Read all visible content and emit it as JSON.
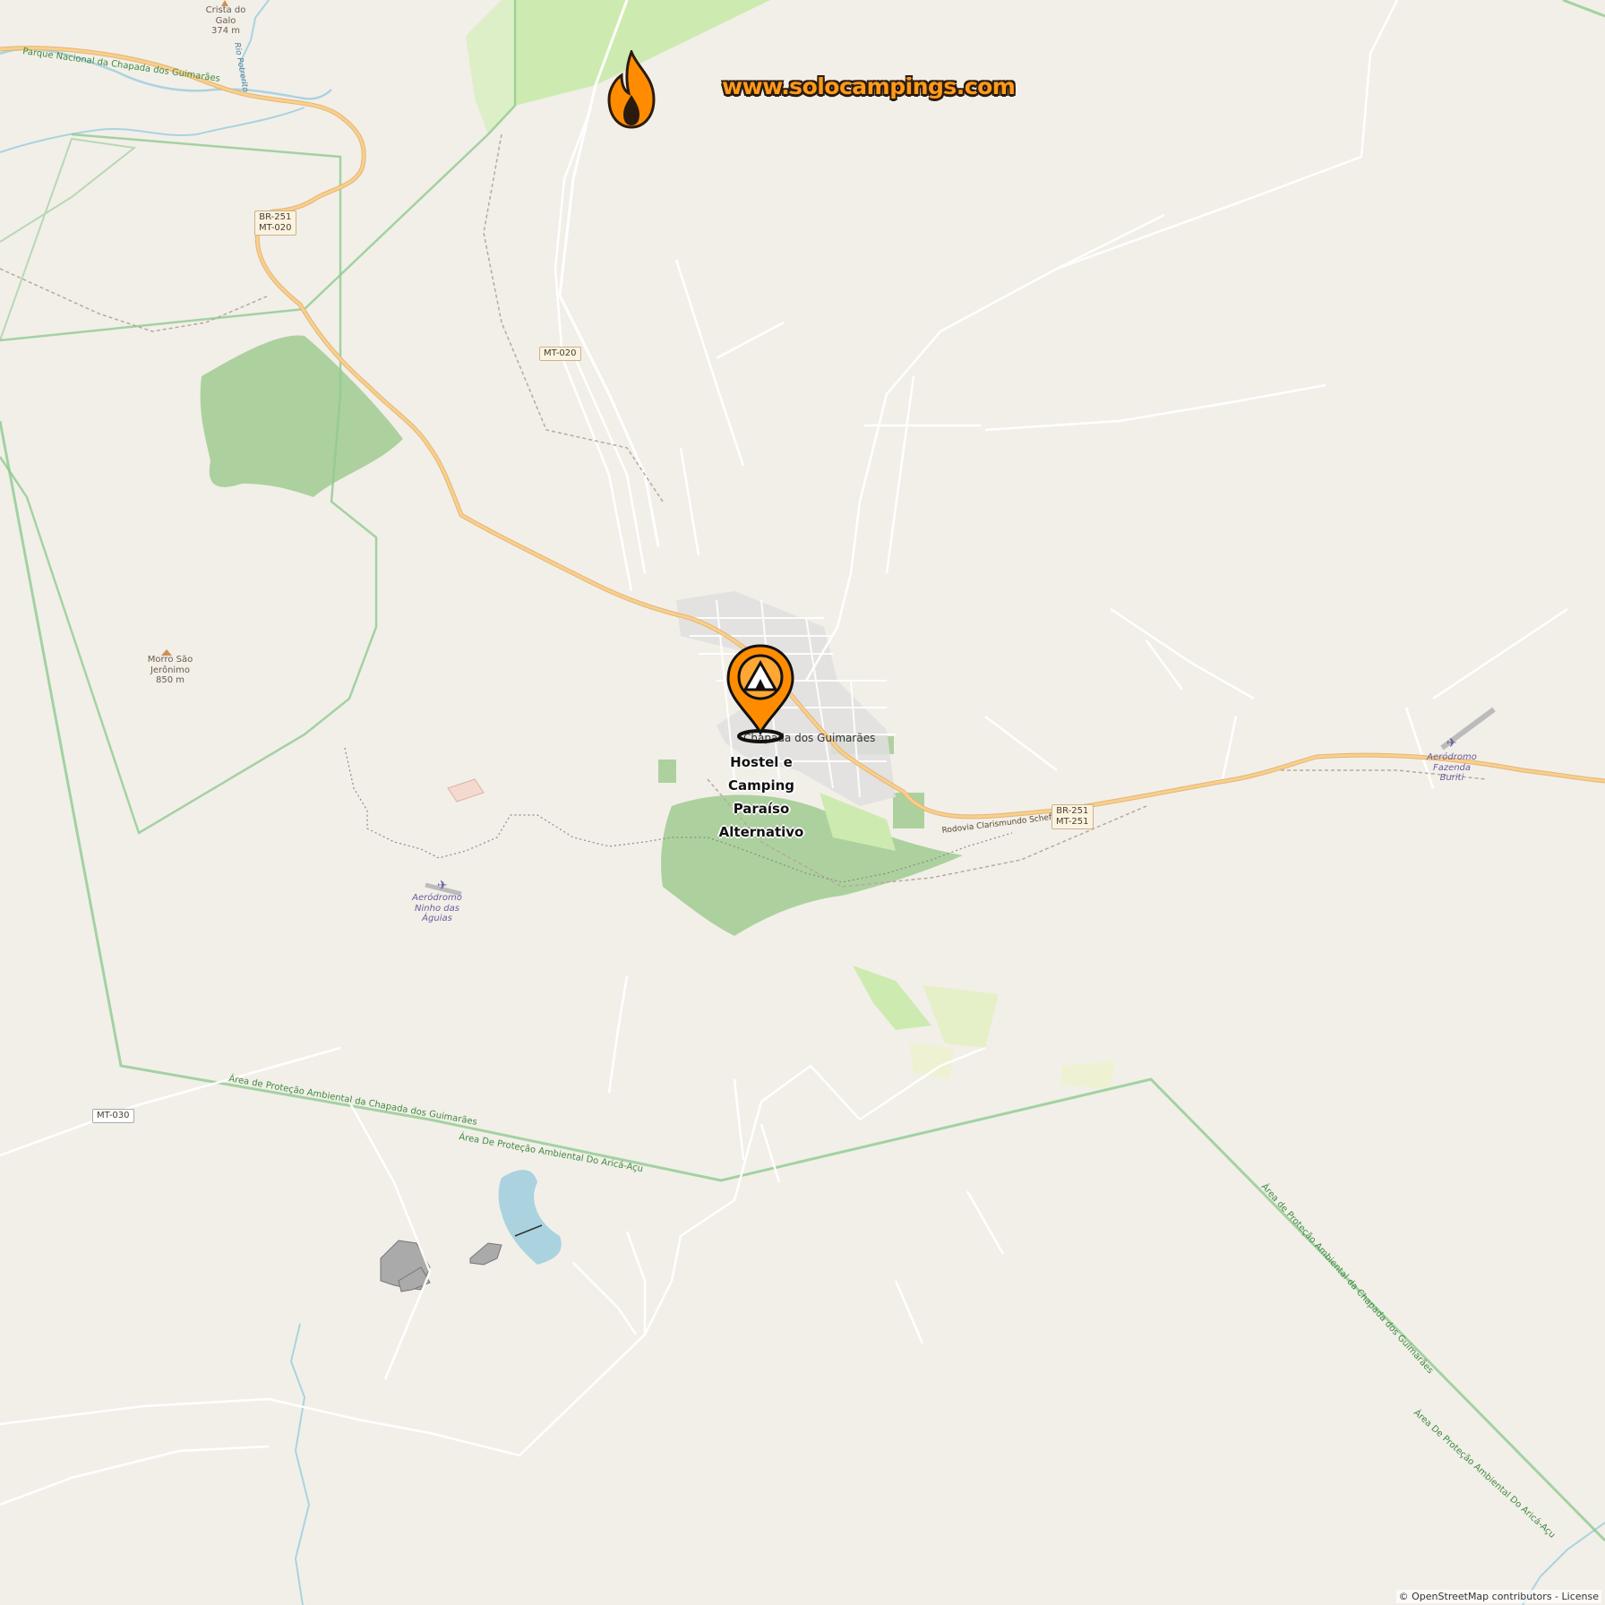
{
  "brand": {
    "text": "www.solocampings.com",
    "accent": "#ff9a1a"
  },
  "poi": {
    "name_lines": [
      "Hostel e",
      "Camping",
      "Paraíso",
      "Alternativo"
    ],
    "icon": "tent-map-pin-icon",
    "color": "#ff8c00"
  },
  "places": {
    "crista_do_galo": {
      "name": "Crista do Galo",
      "elevation": "374 m"
    },
    "morro_sao_jeronimo": {
      "name": "Morro São Jerônimo",
      "elevation": "850 m"
    },
    "town": {
      "name": "Chapada dos Guimarães"
    },
    "aerodromo_ninho": {
      "name": "Aeródromo Ninho das Águias"
    },
    "aerodromo_buriti": {
      "name": "Aeródromo Fazenda Buriti"
    }
  },
  "roads": {
    "br251_mt020": [
      "BR-251",
      "MT-020"
    ],
    "mt020": "MT-020",
    "br251_mt251": [
      "BR-251",
      "MT-251"
    ],
    "mt030": "MT-030",
    "rodovia": "Rodovia Clarismundo Scheffer",
    "rio": "Rio Potrerito"
  },
  "areas": {
    "parque": "Parque Nacional da Chapada dos Guimarães",
    "apa_chapada": "Área de Proteção Ambiental da Chapada dos Guimarães",
    "apa_arica": "Área De Proteção Ambiental Do Aricá-Açu"
  },
  "attribution": {
    "text": "© OpenStreetMap contributors",
    "separator": " - ",
    "license": "License"
  },
  "colors": {
    "land": "#f2efe9",
    "forest": "#add19e",
    "park": "#cdebb0",
    "road": "#f7d08a",
    "water": "#aad3df",
    "boundary": "#8fca8f"
  }
}
